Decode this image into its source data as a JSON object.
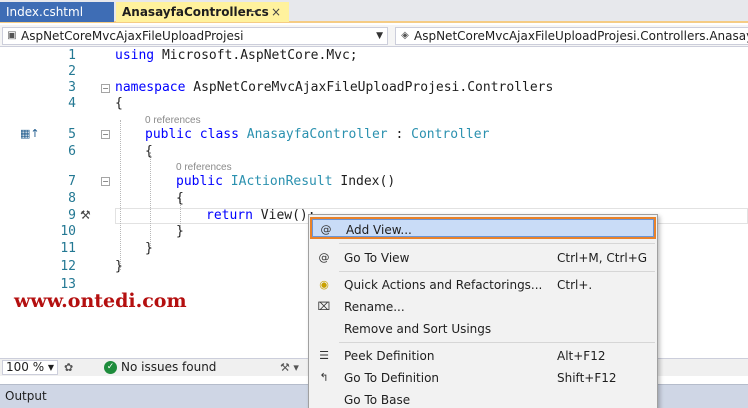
{
  "tabs": [
    {
      "label": "Index.cshtml",
      "active": false
    },
    {
      "label": "AnasayfaController.cs",
      "active": true,
      "pin": "⊸",
      "close": "×"
    }
  ],
  "navbar": {
    "project": "AspNetCoreMvcAjaxFileUploadProjesi",
    "class_path": "AspNetCoreMvcAjaxFileUploadProjesi.Controllers.AnasayfaCo"
  },
  "editor": {
    "line_numbers": [
      "1",
      "2",
      "3",
      "4",
      "5",
      "6",
      "7",
      "8",
      "9",
      "10",
      "11",
      "12",
      "13"
    ],
    "code": {
      "l1_kw": "using",
      "l1_rest": " Microsoft.AspNetCore.Mvc;",
      "l3_kw": "namespace",
      "l3_rest": " AspNetCoreMvcAjaxFileUploadProjesi.Controllers",
      "brace_open": "{",
      "brace_close": "}",
      "l5_kw": "public class",
      "l5_name": " AnasayfaController",
      "l5_colon": " : ",
      "l5_base": "Controller",
      "l7_kw": "public",
      "l7_type": " IActionResult",
      "l7_rest": " Index()",
      "l9_kw": "return",
      "l9_rest": " View();"
    },
    "references_label": "0 references"
  },
  "watermark": "www.ontedi.com",
  "status": {
    "zoom": "100 %",
    "issues": "No issues found"
  },
  "output": {
    "title": "Output"
  },
  "context_menu": {
    "items": [
      {
        "label": "Add View...",
        "shortcut": "",
        "icon": "add-view-icon",
        "highlighted": true
      },
      {
        "label": "Go To View",
        "shortcut": "Ctrl+M, Ctrl+G",
        "icon": "go-to-view-icon"
      },
      {
        "label": "Quick Actions and Refactorings...",
        "shortcut": "Ctrl+.",
        "icon": "lightbulb-icon"
      },
      {
        "label": "Rename...",
        "shortcut": "",
        "icon": "rename-icon"
      },
      {
        "label": "Remove and Sort Usings",
        "shortcut": "",
        "icon": ""
      },
      {
        "label": "Peek Definition",
        "shortcut": "Alt+F12",
        "icon": "peek-definition-icon"
      },
      {
        "label": "Go To Definition",
        "shortcut": "Shift+F12",
        "icon": "go-to-definition-icon"
      },
      {
        "label": "Go To Base",
        "shortcut": "",
        "icon": ""
      }
    ]
  },
  "colors": {
    "accent_tab": "#3e6db5",
    "active_tab": "#fff29d",
    "keyword": "#0000ff",
    "type": "#2b91af",
    "menu_highlight_border": "#e8822a",
    "watermark": "#b40f0f"
  }
}
